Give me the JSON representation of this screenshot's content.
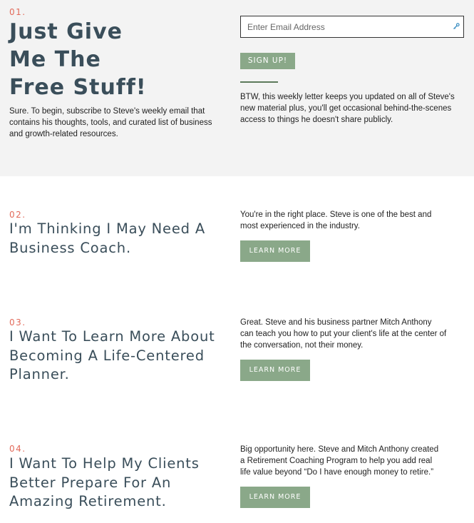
{
  "section1": {
    "number": "01.",
    "heading_lines": [
      "Just Give",
      "Me The",
      "Free Stuff!"
    ],
    "intro": "Sure. To begin, subscribe to Steve's weekly email that contains his thoughts, tools, and curated list of business and growth-related resources.",
    "email_placeholder": "Enter Email Address",
    "signup_label": "SIGN UP!",
    "note": "BTW, this weekly letter keeps you updated on all of Steve's new material plus, you'll get occasional behind-the-scenes access to things he doesn't share publicly."
  },
  "section2": {
    "number": "02.",
    "heading_lines": [
      "I'm Thinking I May Need A",
      "Business Coach."
    ],
    "copy": "You're in the right place. Steve is one of the best and most experienced in the industry.",
    "button_label": "LEARN MORE"
  },
  "section3": {
    "number": "03.",
    "heading_lines": [
      "I Want To Learn More About",
      "Becoming A Life-Centered",
      "Planner."
    ],
    "copy": "Great. Steve and his business partner Mitch Anthony can teach you how to put your client's life at the center of the conversation, not their money.",
    "button_label": "LEARN MORE"
  },
  "section4": {
    "number": "04.",
    "heading_lines": [
      "I Want To Help My Clients",
      "Better Prepare For An",
      "Amazing Retirement."
    ],
    "copy": "Big opportunity here. Steve and Mitch Anthony created a Retirement Coaching Program to help you add real life value beyond “Do I have enough money to retire.”",
    "button_label": "LEARN MORE"
  },
  "colors": {
    "accent_number": "#e26a5a",
    "heading": "#3a4e5a",
    "button": "#8aa889",
    "grey_bg": "#f3f3f3"
  }
}
